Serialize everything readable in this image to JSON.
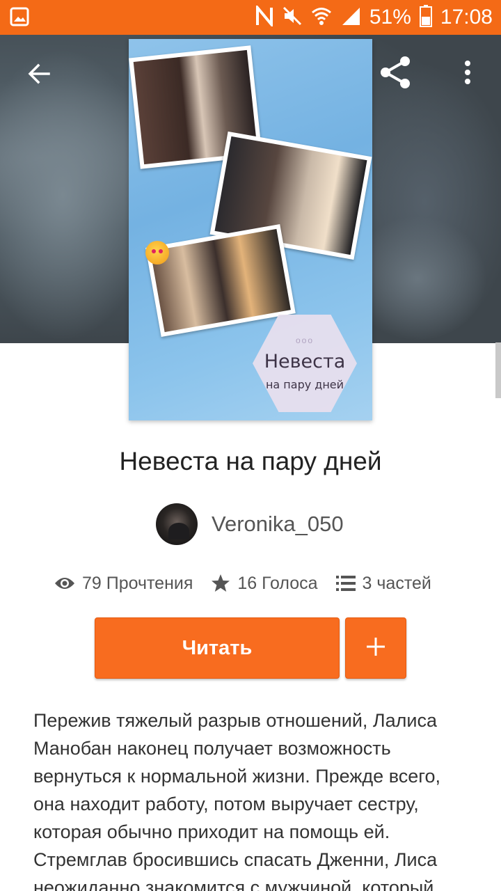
{
  "status_bar": {
    "battery": "51%",
    "time": "17:08",
    "icons": [
      "gallery-icon",
      "nfc-icon",
      "mute-icon",
      "wifi-icon",
      "signal-icon",
      "battery-icon"
    ]
  },
  "toolbar": {
    "back_icon": "arrow-left-icon",
    "share_icon": "share-icon",
    "more_icon": "more-vertical-icon"
  },
  "cover": {
    "title": "Невеста",
    "subtitle": "на пару дней",
    "dots": "ooo"
  },
  "story": {
    "title": "Невеста на пару дней",
    "author": "Veronika_050"
  },
  "stats": {
    "reads": "79 Прочтения",
    "votes": "16 Голоса",
    "parts": "3 частей"
  },
  "actions": {
    "read_label": "Читать",
    "add_label": "+"
  },
  "description": "Пережив тяжелый разрыв отношений, Лалиса Манобан наконец получает возможность вернуться к нормальной жизни. Прежде всего, она находит работу, потом выручает сестру, которая обычно приходит на помощь ей. Стремглав бросившись спасать Дженни, Лиса неожиданно знакомится с мужчиной, который",
  "colors": {
    "status_bar": "#f46a16",
    "accent": "#f86c1f"
  }
}
